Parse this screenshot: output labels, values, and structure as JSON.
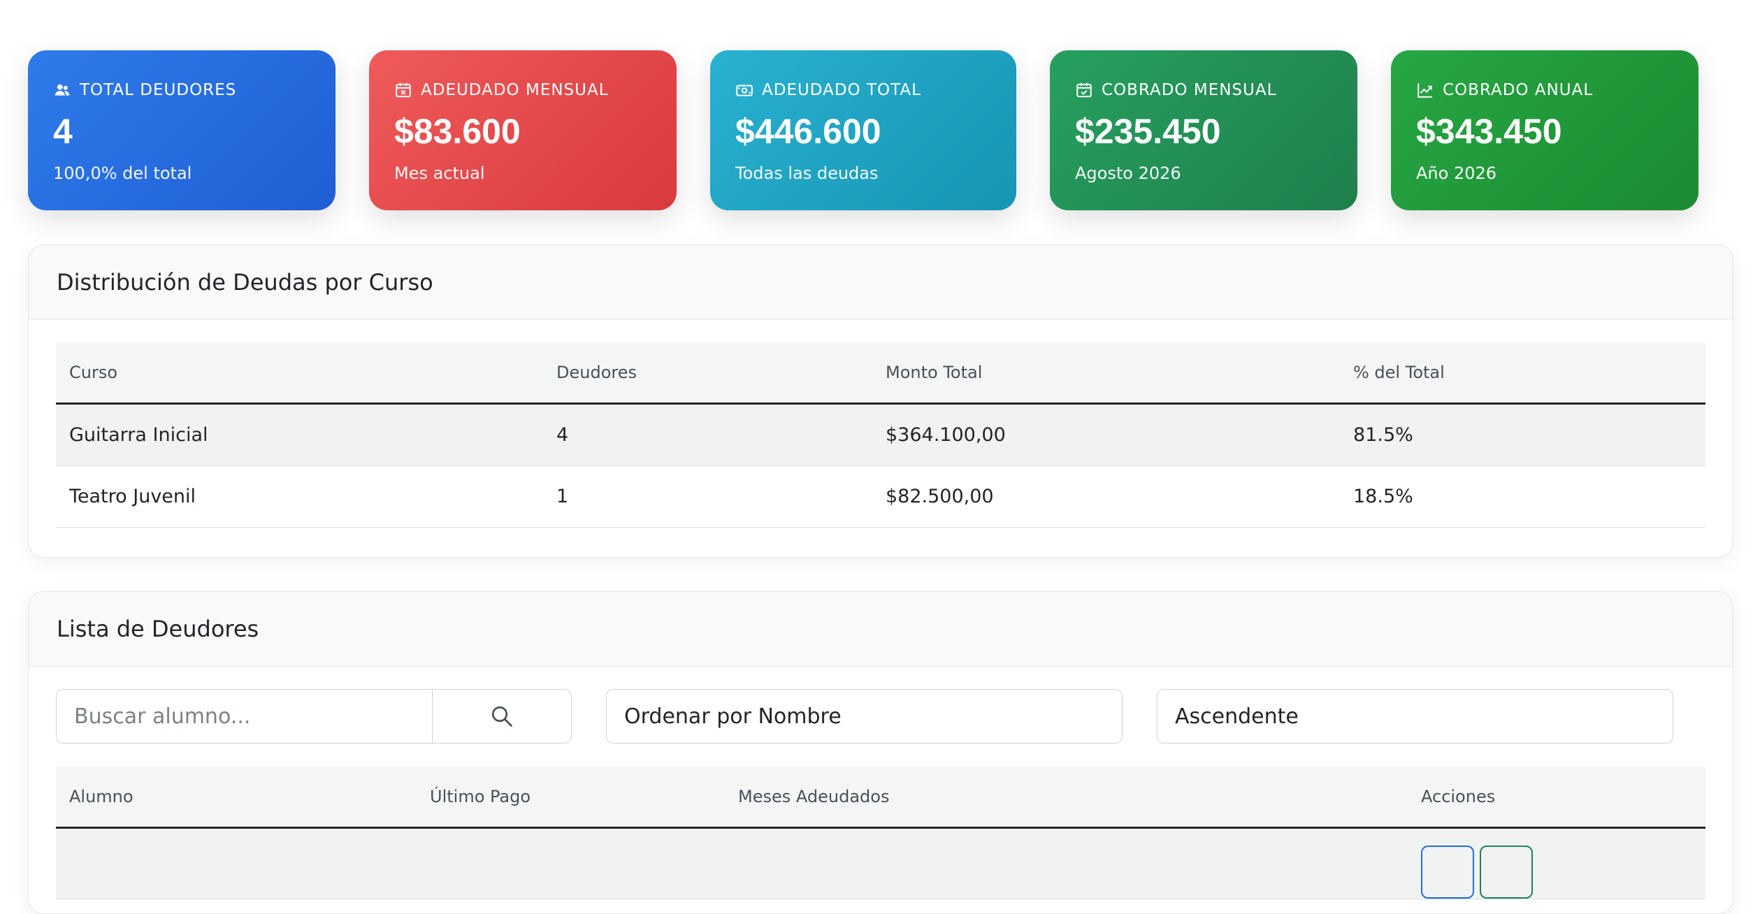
{
  "stats": [
    {
      "title": "TOTAL DEUDORES",
      "value": "4",
      "sub": "100,0% del total",
      "icon": "users-icon",
      "color": "#2a6fe3"
    },
    {
      "title": "ADEUDADO MENSUAL",
      "value": "$83.600",
      "sub": "Mes actual",
      "icon": "calendar-x-icon",
      "color": "#e44a4d"
    },
    {
      "title": "ADEUDADO TOTAL",
      "value": "$446.600",
      "sub": "Todas las deudas",
      "icon": "cash-icon",
      "color": "#22a3c3"
    },
    {
      "title": "COBRADO MENSUAL",
      "value": "$235.450",
      "sub": "Agosto 2026",
      "icon": "calendar-check-icon",
      "color": "#238f56"
    },
    {
      "title": "COBRADO ANUAL",
      "value": "$343.450",
      "sub": "Año 2026",
      "icon": "chart-line-icon",
      "color": "#22983a"
    }
  ],
  "distribution": {
    "title": "Distribución de Deudas por Curso",
    "columns": [
      "Curso",
      "Deudores",
      "Monto Total",
      "% del Total"
    ],
    "rows": [
      [
        "Guitarra Inicial",
        "4",
        "$364.100,00",
        "81.5%"
      ],
      [
        "Teatro Juvenil",
        "1",
        "$82.500,00",
        "18.5%"
      ]
    ]
  },
  "debtors": {
    "title": "Lista de Deudores",
    "search_placeholder": "Buscar alumno...",
    "sort_by": "Ordenar por Nombre",
    "order": "Ascendente",
    "columns": [
      "Alumno",
      "Último Pago",
      "Meses Adeudados",
      "Acciones"
    ]
  }
}
